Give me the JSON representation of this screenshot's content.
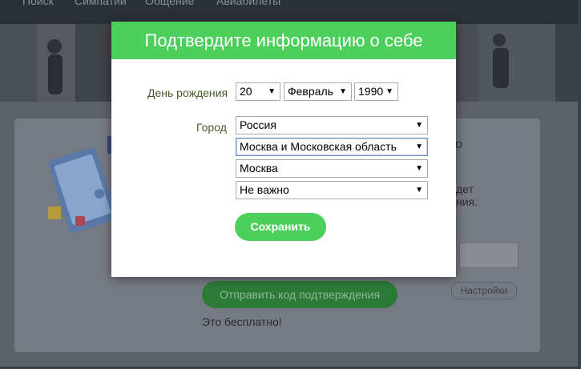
{
  "background": {
    "nav": [
      "Поиск",
      "Симпатии",
      "Общение",
      "Авиабилеты"
    ],
    "right_text_fragments": [
      "о",
      "дет",
      "ния."
    ],
    "send_code_button": "Отправить код подтверждения",
    "settings_button": "Настройки",
    "free_note": "Это бесплатно!"
  },
  "modal": {
    "title": "Подтвердите информацию о себе",
    "birthday_label": "День рождения",
    "day": "20",
    "month": "Февраль",
    "year": "1990",
    "city_label": "Город",
    "country": "Россия",
    "region": "Москва и Московская область",
    "city": "Москва",
    "district": "Не важно",
    "save_button": "Сохранить"
  },
  "colors": {
    "accent_green": "#4cd05b",
    "overlay": "#5d6168"
  },
  "icons": {
    "dropdown_arrow": "triangle-down-icon"
  }
}
